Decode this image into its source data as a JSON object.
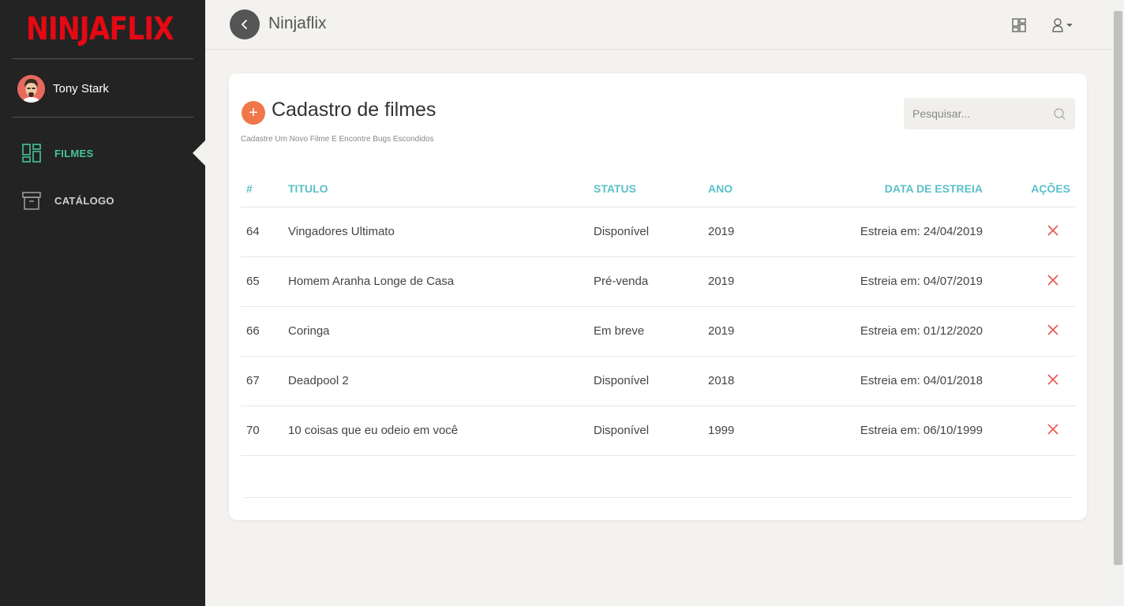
{
  "app": {
    "logo": "NINJAFLIX",
    "top_title": "Ninjaflix"
  },
  "user": {
    "name": "Tony Stark"
  },
  "sidebar": {
    "items": [
      {
        "label": "FILMES",
        "icon": "dashboard-icon",
        "active": true
      },
      {
        "label": "CATÁLOGO",
        "icon": "archive-icon",
        "active": false
      }
    ]
  },
  "page": {
    "title": "Cadastro de filmes",
    "subtitle": "Cadastre Um Novo Filme E Encontre Bugs Escondidos",
    "search_placeholder": "Pesquisar..."
  },
  "table": {
    "headers": {
      "id": "#",
      "title": "TITULO",
      "status": "STATUS",
      "year": "ANO",
      "release": "DATA DE ESTREIA",
      "actions": "AÇÕES"
    },
    "rows": [
      {
        "id": "64",
        "title": "Vingadores Ultimato",
        "status": "Disponível",
        "year": "2019",
        "release": "Estreia em: 24/04/2019"
      },
      {
        "id": "65",
        "title": "Homem Aranha Longe de Casa",
        "status": "Pré-venda",
        "year": "2019",
        "release": "Estreia em: 04/07/2019"
      },
      {
        "id": "66",
        "title": "Coringa",
        "status": "Em breve",
        "year": "2019",
        "release": "Estreia em: 01/12/2020"
      },
      {
        "id": "67",
        "title": "Deadpool 2",
        "status": "Disponível",
        "year": "2018",
        "release": "Estreia em: 04/01/2018"
      },
      {
        "id": "70",
        "title": "10 coisas que eu odeio em você",
        "status": "Disponível",
        "year": "1999",
        "release": "Estreia em: 06/10/1999"
      }
    ]
  },
  "colors": {
    "brand": "#e50914",
    "accent": "#46c596",
    "header": "#5bc0c9",
    "add": "#f0774a",
    "delete": "#e8574d"
  }
}
